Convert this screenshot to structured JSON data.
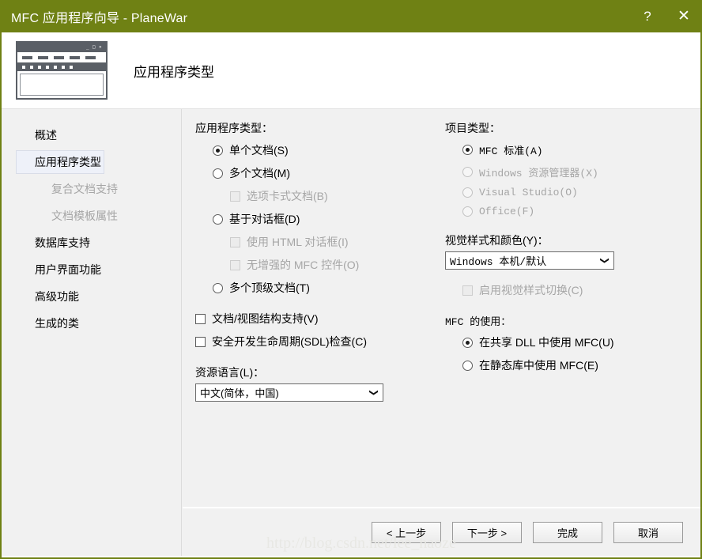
{
  "titlebar": {
    "title": "MFC 应用程序向导 - PlaneWar",
    "help_label": "?",
    "close_label": "✕",
    "background_color": "#6f8114",
    "text_color": "#ffffff"
  },
  "header": {
    "page_title": "应用程序类型",
    "icon": "application-window-icon"
  },
  "sidebar": {
    "items": [
      {
        "label": "概述",
        "selected": false,
        "indent": false,
        "disabled": false
      },
      {
        "label": "应用程序类型",
        "selected": true,
        "indent": false,
        "disabled": false
      },
      {
        "label": "复合文档支持",
        "selected": false,
        "indent": true,
        "disabled": true
      },
      {
        "label": "文档模板属性",
        "selected": false,
        "indent": true,
        "disabled": true
      },
      {
        "label": "数据库支持",
        "selected": false,
        "indent": false,
        "disabled": false
      },
      {
        "label": "用户界面功能",
        "selected": false,
        "indent": false,
        "disabled": false
      },
      {
        "label": "高级功能",
        "selected": false,
        "indent": false,
        "disabled": false
      },
      {
        "label": "生成的类",
        "selected": false,
        "indent": false,
        "disabled": false
      }
    ],
    "selected_bg": "#eef1f9"
  },
  "left_column": {
    "app_type_group_label": "应用程序类型：",
    "app_type_options": [
      {
        "label": "单个文档(S)",
        "checked": true,
        "disabled": false
      },
      {
        "label": "多个文档(M)",
        "checked": false,
        "disabled": false
      },
      {
        "label": "基于对话框(D)",
        "checked": false,
        "disabled": false
      },
      {
        "label": "多个顶级文档(T)",
        "checked": false,
        "disabled": false
      }
    ],
    "tabbed_doc_checkbox": {
      "label": "选项卡式文档(B)",
      "checked": false,
      "disabled": true
    },
    "html_dialog_checkbox": {
      "label": "使用 HTML 对话框(I)",
      "checked": false,
      "disabled": true
    },
    "no_mfc_controls_checkbox": {
      "label": "无增强的 MFC 控件(O)",
      "checked": false,
      "disabled": true
    },
    "doc_view_checkbox": {
      "label": "文档/视图结构支持(V)",
      "checked": false,
      "disabled": false
    },
    "sdl_checkbox": {
      "label": "安全开发生命周期(SDL)检查(C)",
      "checked": false,
      "disabled": false
    },
    "resource_language_label": "资源语言(L)：",
    "resource_language_value": "中文(简体，中国)"
  },
  "right_column": {
    "project_style_group_label": "项目类型：",
    "project_style_options": [
      {
        "label": "MFC 标准(A)",
        "checked": true,
        "disabled": false
      },
      {
        "label": "Windows 资源管理器(X)",
        "checked": false,
        "disabled": true
      },
      {
        "label": "Visual Studio(O)",
        "checked": false,
        "disabled": true
      },
      {
        "label": "Office(F)",
        "checked": false,
        "disabled": true
      }
    ],
    "visual_style_label": "视觉样式和颜色(Y)：",
    "visual_style_value": "Windows 本机/默认",
    "enable_style_switch_checkbox": {
      "label": "启用视觉样式切换(C)",
      "checked": false,
      "disabled": true
    },
    "mfc_use_group_label": "MFC 的使用：",
    "mfc_use_options": [
      {
        "label": "在共享 DLL 中使用 MFC(U)",
        "checked": true,
        "disabled": false
      },
      {
        "label": "在静态库中使用 MFC(E)",
        "checked": false,
        "disabled": false
      }
    ]
  },
  "footer": {
    "back_label": "< 上一步",
    "next_label": "下一步 >",
    "finish_label": "完成",
    "cancel_label": "取消"
  },
  "watermark": {
    "text": "http://blog.csdn.net/lee_haoze"
  }
}
